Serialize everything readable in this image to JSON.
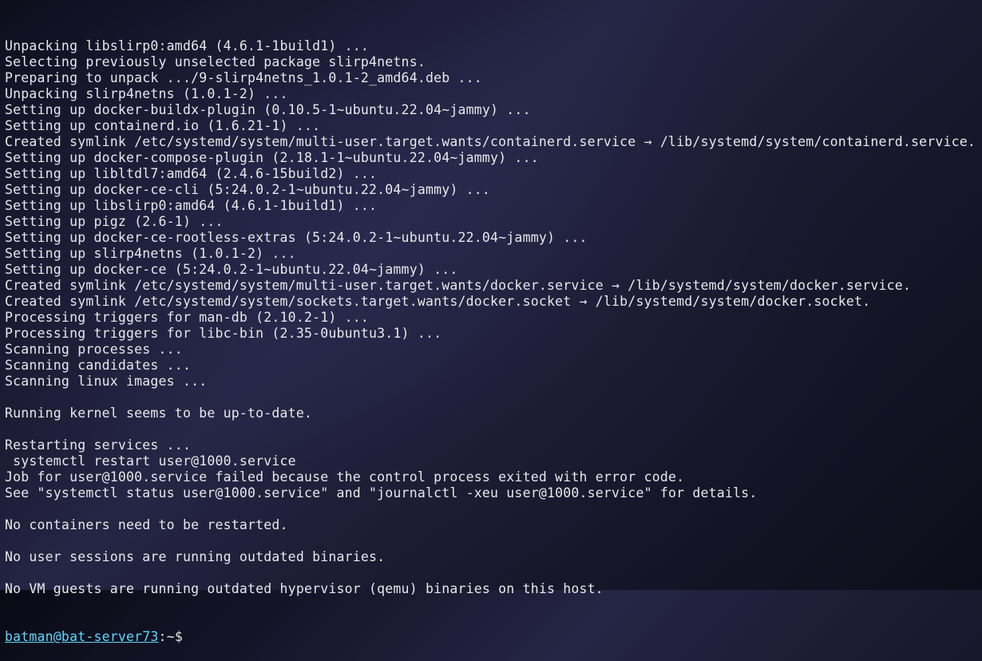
{
  "terminal": {
    "lines": [
      "Unpacking libslirp0:amd64 (4.6.1-1build1) ...",
      "Selecting previously unselected package slirp4netns.",
      "Preparing to unpack .../9-slirp4netns_1.0.1-2_amd64.deb ...",
      "Unpacking slirp4netns (1.0.1-2) ...",
      "Setting up docker-buildx-plugin (0.10.5-1~ubuntu.22.04~jammy) ...",
      "Setting up containerd.io (1.6.21-1) ...",
      "Created symlink /etc/systemd/system/multi-user.target.wants/containerd.service → /lib/systemd/system/containerd.service.",
      "Setting up docker-compose-plugin (2.18.1-1~ubuntu.22.04~jammy) ...",
      "Setting up libltdl7:amd64 (2.4.6-15build2) ...",
      "Setting up docker-ce-cli (5:24.0.2-1~ubuntu.22.04~jammy) ...",
      "Setting up libslirp0:amd64 (4.6.1-1build1) ...",
      "Setting up pigz (2.6-1) ...",
      "Setting up docker-ce-rootless-extras (5:24.0.2-1~ubuntu.22.04~jammy) ...",
      "Setting up slirp4netns (1.0.1-2) ...",
      "Setting up docker-ce (5:24.0.2-1~ubuntu.22.04~jammy) ...",
      "Created symlink /etc/systemd/system/multi-user.target.wants/docker.service → /lib/systemd/system/docker.service.",
      "Created symlink /etc/systemd/system/sockets.target.wants/docker.socket → /lib/systemd/system/docker.socket.",
      "Processing triggers for man-db (2.10.2-1) ...",
      "Processing triggers for libc-bin (2.35-0ubuntu3.1) ...",
      "Scanning processes ...",
      "Scanning candidates ...",
      "Scanning linux images ...",
      "",
      "Running kernel seems to be up-to-date.",
      "",
      "Restarting services ...",
      " systemctl restart user@1000.service",
      "Job for user@1000.service failed because the control process exited with error code.",
      "See \"systemctl status user@1000.service\" and \"journalctl -xeu user@1000.service\" for details.",
      "",
      "No containers need to be restarted.",
      "",
      "No user sessions are running outdated binaries.",
      "",
      "No VM guests are running outdated hypervisor (qemu) binaries on this host."
    ],
    "prompt": {
      "user_host": "batman@bat-server73",
      "separator": ":",
      "path": "~",
      "symbol": "$"
    }
  }
}
